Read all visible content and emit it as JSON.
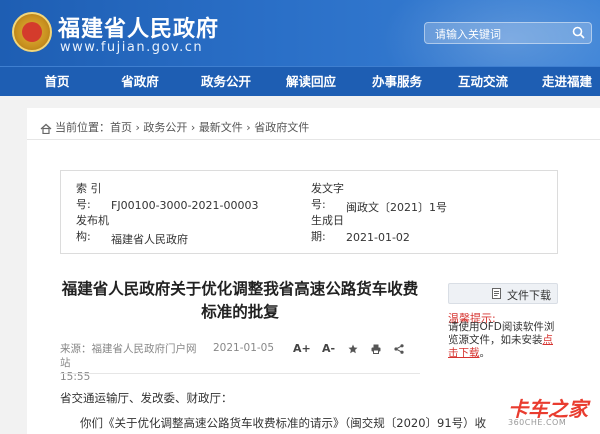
{
  "header": {
    "site_title": "福建省人民政府",
    "site_url": "www.fujian.gov.cn",
    "search_placeholder": "请输入关键词"
  },
  "nav": {
    "items": [
      "首页",
      "省政府",
      "政务公开",
      "解读回应",
      "办事服务",
      "互动交流",
      "走进福建"
    ]
  },
  "breadcrumb": {
    "prefix": "当前位置：",
    "path": [
      "首页",
      "政务公开",
      "最新文件",
      "省政府文件"
    ],
    "separator": " › "
  },
  "meta": {
    "index_label_1": "索 引",
    "index_label_2": "号:",
    "index_value": "FJ00100-3000-2021-00003",
    "docno_label_1": "发文字",
    "docno_label_2": "号:",
    "docno_value": "闽政文〔2021〕1号",
    "publisher_label_1": "发布机",
    "publisher_label_2": "构:",
    "publisher_value": "福建省人民政府",
    "date_label_1": "生成日",
    "date_label_2": "期:",
    "date_value": "2021-01-02"
  },
  "document": {
    "title": "福建省人民政府关于优化调整我省高速公路货车收费标准的批复",
    "source_line_1": "来源：福建省人民政府门户网站",
    "source_line_2": "15:55",
    "date": "2021-01-05",
    "font_increase": "A+",
    "font_decrease": "A-",
    "recipient": "省交通运输厅、发改委、财政厅：",
    "paragraph_1": "你们《关于优化调整高速公路货车收费标准的请示》（闽交规〔2020〕91号）收"
  },
  "sidebar": {
    "download_label": "文件下载",
    "tip_title": "温馨提示:",
    "tip_body": "请使用OFD阅读软件浏览源文件，如未安装",
    "tip_link": "点击下载",
    "tip_end": "。"
  },
  "watermark": {
    "text": "卡车之家",
    "sub": "360CHE.COM"
  }
}
